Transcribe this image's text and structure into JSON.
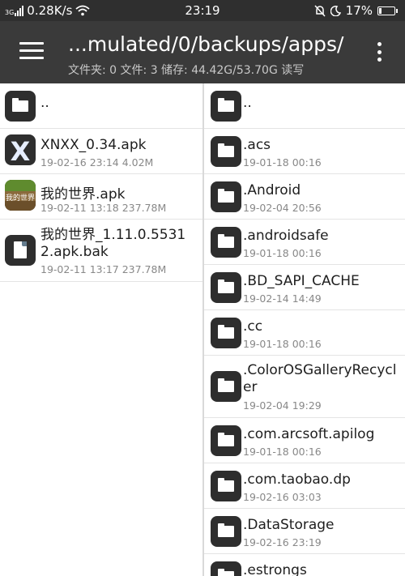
{
  "status_bar": {
    "signal": "3G",
    "speed": "0.28K/s",
    "time": "23:19",
    "battery": "17%",
    "battery_level": 0.17
  },
  "app_bar": {
    "path": "...mulated/0/backups/apps/",
    "info": "文件夹: 0  文件: 3  储存: 44.42G/53.70G  读写"
  },
  "left_pane": {
    "parent": "..",
    "files": [
      {
        "name": "XNXX_0.34.apk",
        "meta": "19-02-16 23:14  4.02M",
        "icon": "apk-x-icon",
        "glyph": "X"
      },
      {
        "name": "我的世界.apk",
        "meta": "19-02-11 13:18  237.78M",
        "icon": "minecraft-apk-icon",
        "glyph": "我的世界"
      },
      {
        "name": "我的世界_1.11.0.55312.apk.bak",
        "meta": "19-02-11 13:17  237.78M",
        "icon": "document-icon"
      }
    ]
  },
  "right_pane": {
    "parent": "..",
    "folders": [
      {
        "name": ".acs",
        "meta": "19-01-18 00:16"
      },
      {
        "name": ".Android",
        "meta": "19-02-04 20:56"
      },
      {
        "name": ".androidsafe",
        "meta": "19-01-18 00:16"
      },
      {
        "name": ".BD_SAPI_CACHE",
        "meta": "19-02-14 14:49"
      },
      {
        "name": ".cc",
        "meta": "19-01-18 00:16"
      },
      {
        "name": ".ColorOSGalleryRecycler",
        "meta": "19-02-04 19:29"
      },
      {
        "name": ".com.arcsoft.apilog",
        "meta": "19-01-18 00:16"
      },
      {
        "name": ".com.taobao.dp",
        "meta": "19-02-16 03:03"
      },
      {
        "name": ".DataStorage",
        "meta": "19-02-16 23:19"
      },
      {
        "name": ".estrongs",
        "meta": ""
      }
    ]
  }
}
